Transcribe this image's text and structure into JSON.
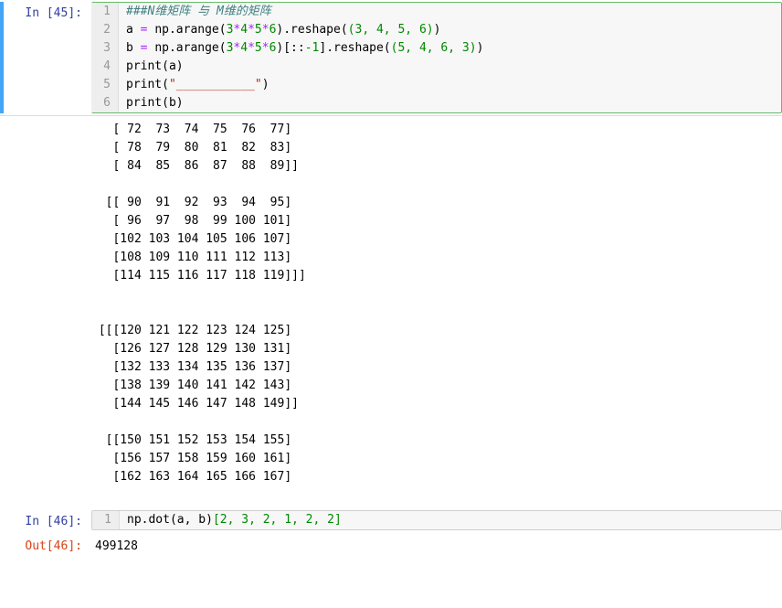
{
  "cell1": {
    "prompt": "In [45]:",
    "lines": {
      "n1": "1",
      "n2": "2",
      "n3": "3",
      "n4": "4",
      "n5": "5",
      "n6": "6"
    },
    "code": {
      "l1_comment": "###N维矩阵 与 M维的矩阵",
      "l2_a": "a ",
      "l2_eq": "= ",
      "l2_np": "np",
      "l2_dot1": ".",
      "l2_arange": "arange",
      "l2_p1": "(",
      "l2_n3": "3",
      "l2_m1": "*",
      "l2_n4": "4",
      "l2_m2": "*",
      "l2_n5": "5",
      "l2_m3": "*",
      "l2_n6": "6",
      "l2_p2": ")",
      "l2_dot2": ".",
      "l2_reshape": "reshape",
      "l2_p3": "(",
      "l2_tuple": "(3, 4, 5, 6)",
      "l2_p4": ")",
      "l3_b": "b ",
      "l3_eq": "= ",
      "l3_np": "np",
      "l3_dot1": ".",
      "l3_arange": "arange",
      "l3_p1": "(",
      "l3_n3": "3",
      "l3_m1": "*",
      "l3_n4": "4",
      "l3_m2": "*",
      "l3_n5": "5",
      "l3_m3": "*",
      "l3_n6": "6",
      "l3_p2": ")",
      "l3_slice": "[::",
      "l3_neg1": "-1",
      "l3_close": "]",
      "l3_dot2": ".",
      "l3_reshape": "reshape",
      "l3_p3": "(",
      "l3_tuple": "(5, 4, 6, 3)",
      "l3_p4": ")",
      "l4_print": "print",
      "l4_p1": "(",
      "l4_a": "a",
      "l4_p2": ")",
      "l5_print": "print",
      "l5_p1": "(",
      "l5_str": "\"___________\"",
      "l5_p2": ")",
      "l6_print": "print",
      "l6_p1": "(",
      "l6_b": "b",
      "l6_p2": ")"
    }
  },
  "output1": "   [ 72  73  74  75  76  77]\n   [ 78  79  80  81  82  83]\n   [ 84  85  86  87  88  89]]\n\n  [[ 90  91  92  93  94  95]\n   [ 96  97  98  99 100 101]\n   [102 103 104 105 106 107]\n   [108 109 110 111 112 113]\n   [114 115 116 117 118 119]]]\n\n\n [[[120 121 122 123 124 125]\n   [126 127 128 129 130 131]\n   [132 133 134 135 136 137]\n   [138 139 140 141 142 143]\n   [144 145 146 147 148 149]]\n\n  [[150 151 152 153 154 155]\n   [156 157 158 159 160 161]\n   [162 163 164 165 166 167]",
  "cell2": {
    "prompt": "In [46]:",
    "lineno": "1",
    "code": {
      "np": "np",
      "dot": ".",
      "dotfn": "dot",
      "p1": "(",
      "a": "a",
      "comma": ", ",
      "b": "b",
      "p2": ")",
      "idx": "[2, 3, 2, 1, 2, 2]"
    }
  },
  "out2": {
    "prompt": "Out[46]:",
    "value": "499128"
  }
}
